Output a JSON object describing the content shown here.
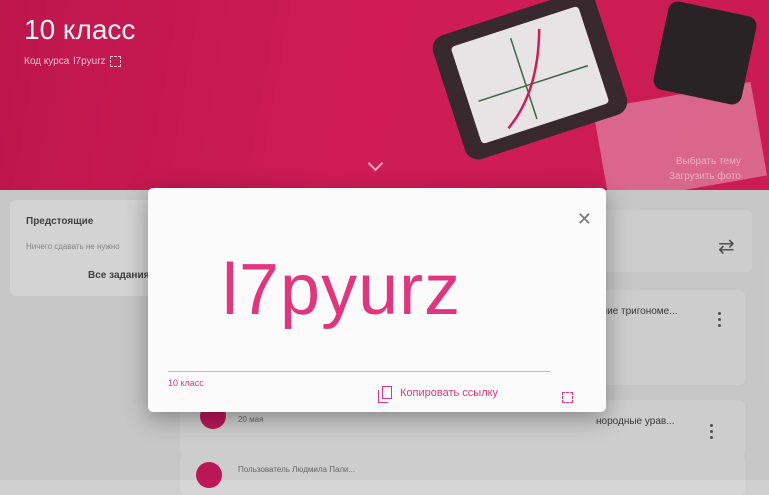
{
  "banner": {
    "title": "10 класс",
    "course_code_label": "Код курса",
    "course_code_value": "l7pyurz",
    "select_theme": "Выбрать тему",
    "upload_photo": "Загрузить фото"
  },
  "upcoming": {
    "title": "Предстоящие",
    "empty": "Ничего сдавать не нужно",
    "all_tasks": "Все задания"
  },
  "stream": {
    "card2_title": "ение тригономе...",
    "card3_title": "нородные урав...",
    "card3_date": "20 мая",
    "card4_user": "Пользователь Людмила Пали..."
  },
  "modal": {
    "code": "l7pyurz",
    "course_name": "10 класс",
    "copy_link": "Копировать ссылку"
  },
  "icons": {
    "close": "close-icon",
    "copy": "copy-icon",
    "fullscreen": "fullscreen-icon",
    "repeat": "repeat-icon",
    "more": "more-vert-icon",
    "chevron": "chevron-down-icon"
  },
  "colors": {
    "banner": "#d81e5b",
    "accent": "#e1367e"
  }
}
